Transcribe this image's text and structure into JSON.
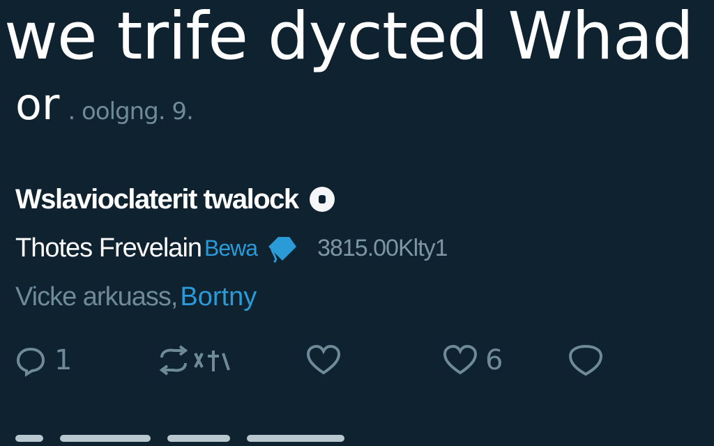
{
  "post": {
    "headline": "we trife dycted Whad c",
    "subline_main": "or",
    "subline_secondary": ". oolgng. 9."
  },
  "author": {
    "name": "Wslavioclaterit twalock",
    "badge_icon": "verified-badge-icon"
  },
  "detail": {
    "lead": "Thotes Frevelain",
    "link": "Bewa",
    "gem_icon": "diamond-icon",
    "meta": "3815.00Klty1"
  },
  "meta": {
    "muted": "Vicke arkuass,",
    "accent": "Bortny"
  },
  "actions": {
    "reply": {
      "icon": "reply-icon",
      "count": "1"
    },
    "repost": {
      "icon": "repost-icon",
      "count": ""
    },
    "like": {
      "icon": "heart-icon",
      "count": ""
    },
    "views": {
      "icon": "heart-icon",
      "count": "6"
    },
    "share": {
      "icon": "share-icon",
      "count": ""
    }
  },
  "colors": {
    "background": "#0f2230",
    "text": "#ffffff",
    "muted": "#6f8b98",
    "accent": "#2a9bd6"
  }
}
